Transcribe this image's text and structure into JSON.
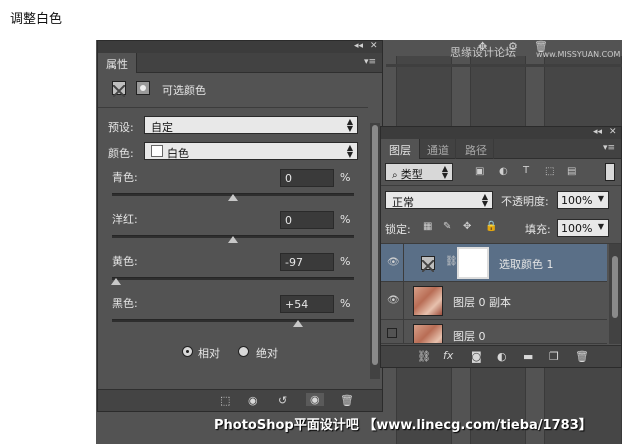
{
  "page_heading": "调整白色",
  "watermark": {
    "top": "思缘设计论坛",
    "top_url": "www.MISSYUAN.COM",
    "bottom": "PhotoShop平面设计吧 【www.linecg.com/tieba/1783】"
  },
  "properties": {
    "tab": "属性",
    "adjustment_title": "可选颜色",
    "preset_label": "预设:",
    "preset_value": "自定",
    "colors_label": "颜色:",
    "colors_value": "白色",
    "sliders": [
      {
        "label": "青色:",
        "value": "0",
        "unit": "%",
        "level": 0
      },
      {
        "label": "洋红:",
        "value": "0",
        "unit": "%",
        "level": 0
      },
      {
        "label": "黄色:",
        "value": "-97",
        "unit": "%",
        "level": -97
      },
      {
        "label": "黑色:",
        "value": "+54",
        "unit": "%",
        "level": 54
      }
    ],
    "method": {
      "relative": "相对",
      "absolute": "绝对",
      "selected": "relative"
    }
  },
  "layers": {
    "tabs": [
      "图层",
      "通道",
      "路径"
    ],
    "filter_kind": "类型",
    "blend_mode": "正常",
    "opacity_label": "不透明度:",
    "opacity_value": "100%",
    "lock_label": "锁定:",
    "fill_label": "填充:",
    "fill_value": "100%",
    "items": [
      {
        "name": "选取颜色 1",
        "type": "adjustment",
        "selected": true,
        "visible": true
      },
      {
        "name": "图层 0 副本",
        "type": "image",
        "selected": false,
        "visible": true
      },
      {
        "name": "图层 0",
        "type": "image",
        "selected": false,
        "visible": false
      }
    ]
  }
}
